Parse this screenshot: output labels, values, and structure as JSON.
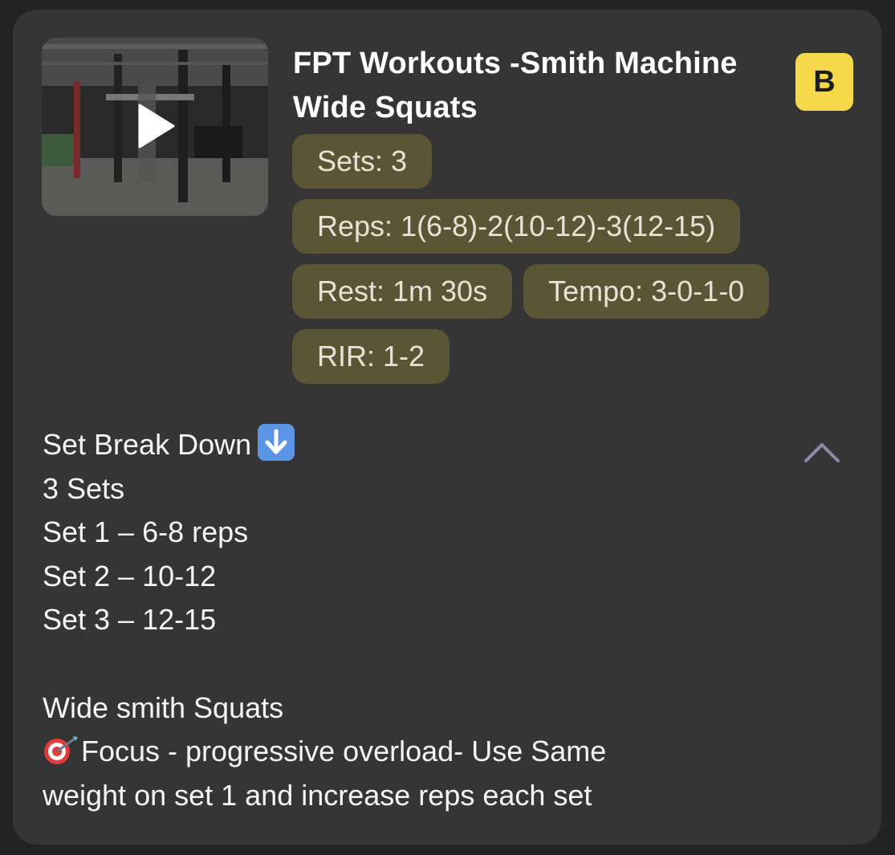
{
  "workout": {
    "title": "FPT Workouts -Smith Machine Wide Squats",
    "badge": "B",
    "thumbnail_icon": "play-icon",
    "chips": {
      "sets": "Sets: 3",
      "reps": "Reps: 1(6-8)-2(10-12)-3(12-15)",
      "rest": "Rest: 1m 30s",
      "tempo": "Tempo: 3-0-1-0",
      "rir": "RIR: 1-2"
    },
    "collapse_icon": "chevron-up-icon"
  },
  "description": {
    "lines": [
      "Set Break Down",
      "3 Sets",
      "Set 1 – 6-8 reps",
      "Set 2 – 10-12",
      "Set 3 – 12-15",
      "",
      "Wide smith Squats",
      "Focus - progressive overload- Use Same",
      "weight on set 1 and increase reps each set"
    ],
    "line0_icon": "down-arrow-emoji-icon",
    "line7_icon": "target-emoji-icon"
  },
  "colors": {
    "card_bg": "#353535",
    "chip_bg": "#5b5535",
    "badge_bg": "#f6d94a",
    "page_bg": "#242424"
  }
}
